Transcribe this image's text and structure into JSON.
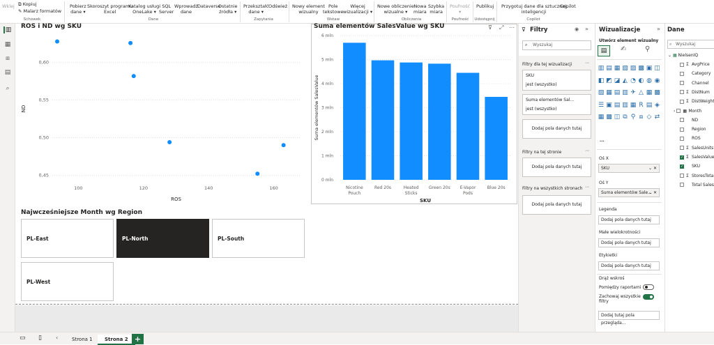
{
  "ribbon": {
    "groups": [
      "Schowek",
      "Dane",
      "Zapytania",
      "Wstaw",
      "Obliczenia",
      "Poufność",
      "Udostępnij",
      "Copilot"
    ],
    "clipboard": {
      "copy": "Kopiuj",
      "painter": "Malarz formatów",
      "paste": "Wklej"
    },
    "data": [
      {
        "l1": "Pobierz",
        "l2": "dane ▾"
      },
      {
        "l1": "Skoroszyt programu",
        "l2": "Excel"
      },
      {
        "l1": "Katalog usługi",
        "l2": "OneLake ▾"
      },
      {
        "l1": "SQL",
        "l2": "Server"
      },
      {
        "l1": "Wprowadź",
        "l2": "dane"
      },
      {
        "l1": "Dataverse",
        "l2": ""
      },
      {
        "l1": "Ostatnie",
        "l2": "źródła ▾"
      }
    ],
    "queries": [
      {
        "l1": "Przekształć",
        "l2": "dane ▾"
      },
      {
        "l1": "Odśwież",
        "l2": ""
      }
    ],
    "insert": [
      {
        "l1": "Nowy element",
        "l2": "wizualny"
      },
      {
        "l1": "Pole",
        "l2": "tekstowe"
      },
      {
        "l1": "Więcej",
        "l2": "wizualizacji ▾"
      }
    ],
    "calc": [
      {
        "l1": "Nowe obliczenie",
        "l2": "wizualne ▾"
      },
      {
        "l1": "Nowa",
        "l2": "miara"
      },
      {
        "l1": "Szybka",
        "l2": "miara"
      }
    ],
    "sens": {
      "l1": "Poufność",
      "l2": "▾"
    },
    "share": {
      "l1": "Publikuj",
      "l2": ""
    },
    "copilot": {
      "l1": "Przygotuj dane dla sztucznej",
      "l2": "inteligencji",
      "l3": "Copilot"
    }
  },
  "scatter": {
    "title": "ROS i ND wg SKU"
  },
  "bar": {
    "title": "Suma elementów SalesValue wg SKU"
  },
  "cards": {
    "title": "Najwcześniejsze Month wg Region",
    "items": [
      "PL-East",
      "PL-North",
      "PL-South",
      "PL-West"
    ],
    "selected_index": 1
  },
  "filters": {
    "title": "Filtry",
    "search_placeholder": "Wyszukaj",
    "this_visual": "Filtry dla tej wizualizacji",
    "f1_name": "SKU",
    "f1_value": "jest (wszystko)",
    "f2_name": "Suma elementów Sal...",
    "f2_value": "jest (wszystko)",
    "add": "Dodaj pola danych tutaj",
    "this_page": "Filtry na tej stronie",
    "all_pages": "Filtry na wszystkich stronach"
  },
  "viz": {
    "title": "Wizualizacje",
    "subtitle": "Utwórz element wizualny",
    "axis_x": "Oś X",
    "axis_x_value": "SKU",
    "axis_y": "Oś Y",
    "axis_y_value": "Suma elementów Sale...",
    "legend": "Legenda",
    "small_multiples": "Małe wielokrotności",
    "tooltips": "Etykietki",
    "add": "Dodaj pola danych tutaj",
    "drill": "Drąż wskroś",
    "cross_report": "Pomiędzy raportami",
    "keep_filters_1": "Zachowaj wszystkie",
    "keep_filters_2": "filtry",
    "drill_add": "Dodaj tutaj pola przeglądа...",
    "dots": "..."
  },
  "data_pane": {
    "title": "Dane",
    "search_placeholder": "Wyszukaj",
    "table": "NielsenIQ",
    "fields": [
      {
        "name": "AvgPrice",
        "sigma": true,
        "checked": false
      },
      {
        "name": "Category",
        "sigma": false,
        "checked": false
      },
      {
        "name": "Channel",
        "sigma": false,
        "checked": false
      },
      {
        "name": "DistNum",
        "sigma": true,
        "checked": false
      },
      {
        "name": "DistWeight",
        "sigma": true,
        "checked": false
      },
      {
        "name": "Month",
        "sigma": false,
        "checked": false,
        "expand": true
      },
      {
        "name": "ND",
        "sigma": false,
        "checked": false
      },
      {
        "name": "Region",
        "sigma": false,
        "checked": false
      },
      {
        "name": "ROS",
        "sigma": false,
        "checked": false
      },
      {
        "name": "SalesUnits",
        "sigma": true,
        "checked": false
      },
      {
        "name": "SalesValue",
        "sigma": true,
        "checked": true
      },
      {
        "name": "SKU",
        "sigma": false,
        "checked": true
      },
      {
        "name": "StoresTotal",
        "sigma": true,
        "checked": false
      },
      {
        "name": "Total Sales",
        "sigma": false,
        "checked": false
      }
    ]
  },
  "tabs": [
    "Strona 1",
    "Strona 2"
  ],
  "add_tab": "+",
  "colors": {
    "accent": "#118dff",
    "green": "#217346",
    "dark": "#252423"
  },
  "chart_data": [
    {
      "type": "scatter",
      "title": "ROS i ND wg SKU",
      "xlabel": "ROS",
      "ylabel": "ND",
      "xlim": [
        92,
        168
      ],
      "ylim": [
        0.442,
        0.635
      ],
      "xticks": [
        "100",
        "120",
        "140",
        "160"
      ],
      "xtick_values": [
        100,
        120,
        140,
        160
      ],
      "yticks": [
        "0,60",
        "0,55",
        "0,50",
        "0,45"
      ],
      "ytick_values": [
        0.6,
        0.55,
        0.5,
        0.45
      ],
      "points": [
        {
          "x": 93.5,
          "y": 0.628
        },
        {
          "x": 116,
          "y": 0.626
        },
        {
          "x": 117,
          "y": 0.582
        },
        {
          "x": 128,
          "y": 0.494
        },
        {
          "x": 155,
          "y": 0.452
        },
        {
          "x": 163,
          "y": 0.49
        }
      ]
    },
    {
      "type": "bar",
      "title": "Suma elementów SalesValue wg SKU",
      "xlabel": "SKU",
      "ylabel": "Suma elementów SalesValue",
      "ylim": [
        0,
        6
      ],
      "yticks": [
        "0 mln",
        "1 mln",
        "2 mln",
        "3 mln",
        "4 mln",
        "5 mln",
        "6 mln"
      ],
      "categories": [
        {
          "l1": "Nicotine",
          "l2": "Pouch"
        },
        {
          "l1": "Red 20s",
          "l2": ""
        },
        {
          "l1": "Heated",
          "l2": "Sticks"
        },
        {
          "l1": "Green 20s",
          "l2": ""
        },
        {
          "l1": "E-Vapor",
          "l2": "Pods"
        },
        {
          "l1": "Blue 20s",
          "l2": ""
        }
      ],
      "values": [
        5.7,
        4.97,
        4.88,
        4.83,
        4.45,
        3.45
      ],
      "color": "#118dff"
    }
  ]
}
